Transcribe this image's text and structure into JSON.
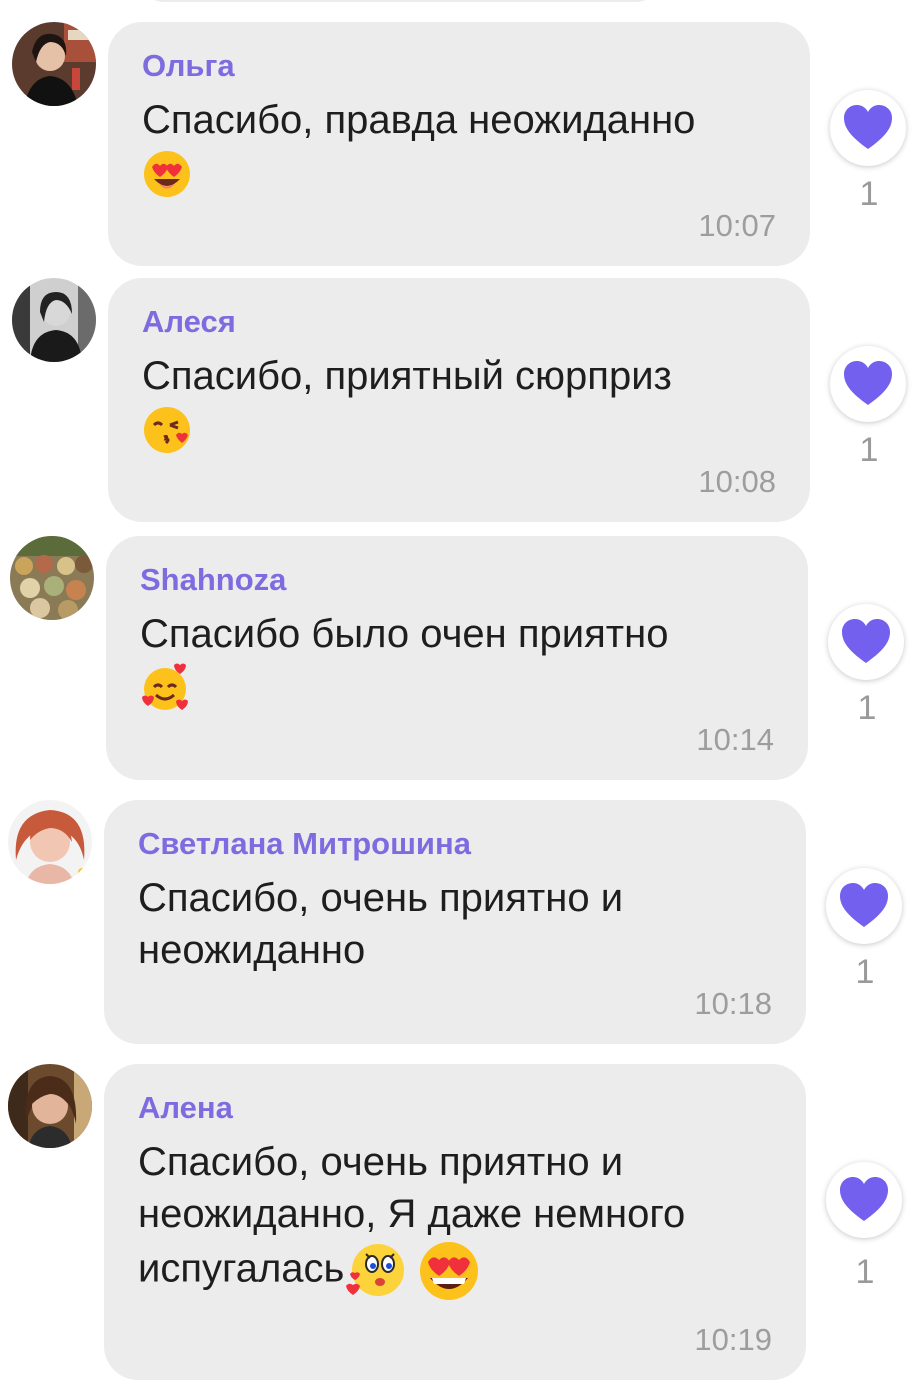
{
  "colors": {
    "accent": "#7e6be0",
    "bubble": "#ececec",
    "heart": "#7360ee",
    "time": "#9d9d9d"
  },
  "messages": [
    {
      "author": "Ольга",
      "text": "Спасибо, правда неожиданно",
      "emoji": [
        "smiling-face-with-heart-eyes"
      ],
      "time": "10:07",
      "likes": "1",
      "avatar": "avatar-olga"
    },
    {
      "author": "Алеся",
      "text": "Спасибо, приятный сюрприз",
      "emoji": [
        "face-blowing-a-kiss"
      ],
      "time": "10:08",
      "likes": "1",
      "avatar": "avatar-alesya"
    },
    {
      "author": "Shahnoza",
      "text": "Спасибо было очен приятно",
      "emoji": [
        "smiling-face-with-hearts"
      ],
      "time": "10:14",
      "likes": "1",
      "avatar": "avatar-shahnoza"
    },
    {
      "author": "Светлана Митрошина",
      "text": "Спасибо, очень приятно и\nнеожиданно",
      "emoji": [],
      "time": "10:18",
      "likes": "1",
      "avatar": "avatar-svetlana"
    },
    {
      "author": "Алена",
      "text": "Спасибо, очень приятно и\nнеожиданно, Я даже немного\nиспугалась",
      "emoji": [
        "kissing-face-sticker",
        "heart-eyes-grin"
      ],
      "time": "10:19",
      "likes": "1",
      "avatar": "avatar-alena"
    }
  ]
}
